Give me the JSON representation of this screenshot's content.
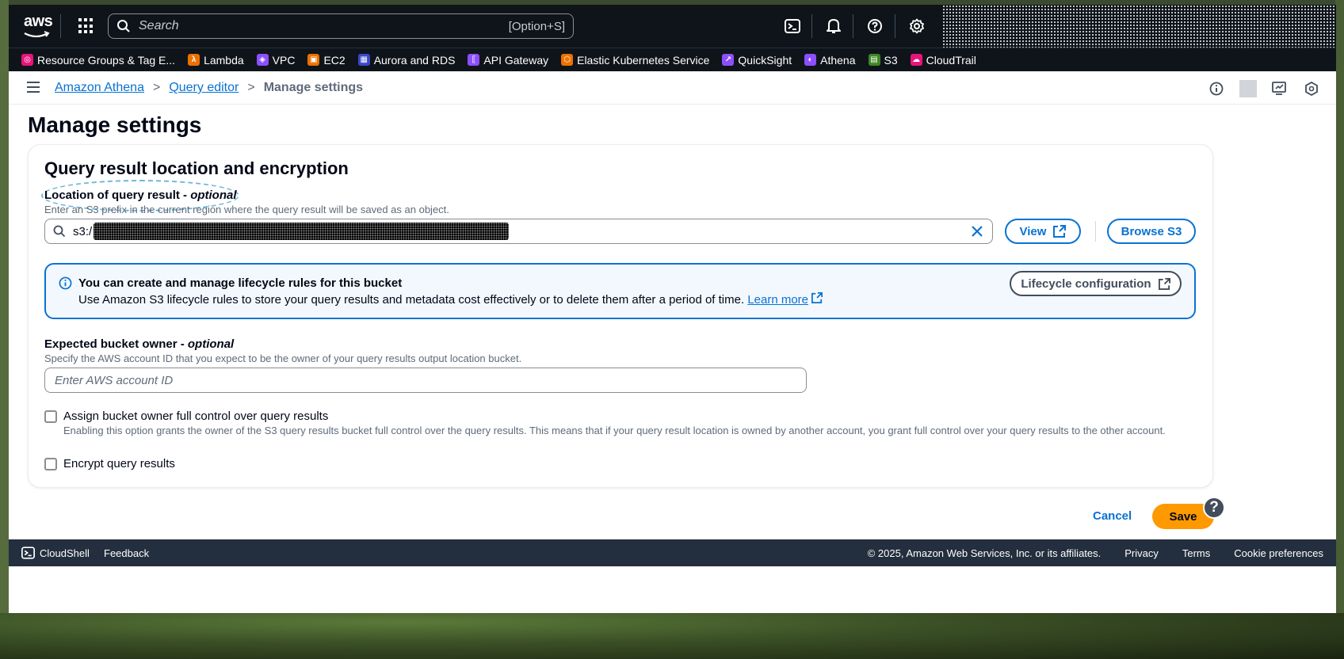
{
  "topnav": {
    "logo_text": "aws",
    "search_placeholder": "Search",
    "search_shortcut": "[Option+S]"
  },
  "favorites": [
    {
      "label": "Resource Groups & Tag E...",
      "color": "#e7157b",
      "icon": "resource-groups-icon"
    },
    {
      "label": "Lambda",
      "color": "#ed7100",
      "icon": "lambda-icon"
    },
    {
      "label": "VPC",
      "color": "#8c4fff",
      "icon": "vpc-icon"
    },
    {
      "label": "EC2",
      "color": "#ed7100",
      "icon": "ec2-icon"
    },
    {
      "label": "Aurora and RDS",
      "color": "#3b48cc",
      "icon": "rds-icon"
    },
    {
      "label": "API Gateway",
      "color": "#8c4fff",
      "icon": "api-gateway-icon"
    },
    {
      "label": "Elastic Kubernetes Service",
      "color": "#ed7100",
      "icon": "eks-icon"
    },
    {
      "label": "QuickSight",
      "color": "#8c4fff",
      "icon": "quicksight-icon"
    },
    {
      "label": "Athena",
      "color": "#8c4fff",
      "icon": "athena-icon"
    },
    {
      "label": "S3",
      "color": "#3f8624",
      "icon": "s3-icon"
    },
    {
      "label": "CloudTrail",
      "color": "#e7157b",
      "icon": "cloudtrail-icon"
    }
  ],
  "breadcrumb": {
    "items": [
      "Amazon Athena",
      "Query editor"
    ],
    "current": "Manage settings"
  },
  "page": {
    "title": "Manage settings",
    "panel_title": "Query result location and encryption",
    "location": {
      "label": "Location of query result - ",
      "label_optional": "optional",
      "description": "Enter an S3 prefix in the current region where the query result will be saved as an object.",
      "value": "s3:/",
      "view_button": "View",
      "browse_button": "Browse S3"
    },
    "info": {
      "title": "You can create and manage lifecycle rules for this bucket",
      "text": "Use Amazon S3 lifecycle rules to store your query results and metadata cost effectively or to delete them after a period of time.",
      "link": "Learn more",
      "button": "Lifecycle configuration"
    },
    "owner": {
      "label": "Expected bucket owner - ",
      "label_optional": "optional",
      "description": "Specify the AWS account ID that you expect to be the owner of your query results output location bucket.",
      "placeholder": "Enter AWS account ID"
    },
    "full_control": {
      "label": "Assign bucket owner full control over query results",
      "description": "Enabling this option grants the owner of the S3 query results bucket full control over the query results. This means that if your query result location is owned by another account, you grant full control over your query results to the other account.",
      "checked": false
    },
    "encrypt": {
      "label": "Encrypt query results",
      "checked": false
    },
    "cancel": "Cancel",
    "save": "Save",
    "help": "?"
  },
  "footer": {
    "cloudshell": "CloudShell",
    "feedback": "Feedback",
    "copyright": "© 2025, Amazon Web Services, Inc. or its affiliates.",
    "privacy": "Privacy",
    "terms": "Terms",
    "cookies": "Cookie preferences"
  },
  "colors": {
    "nav_bg": "#0f141a",
    "link": "#0972d3",
    "primary_button": "#ff9900",
    "footer_bg": "#232f3e",
    "info_bg": "#f2f8fd"
  }
}
